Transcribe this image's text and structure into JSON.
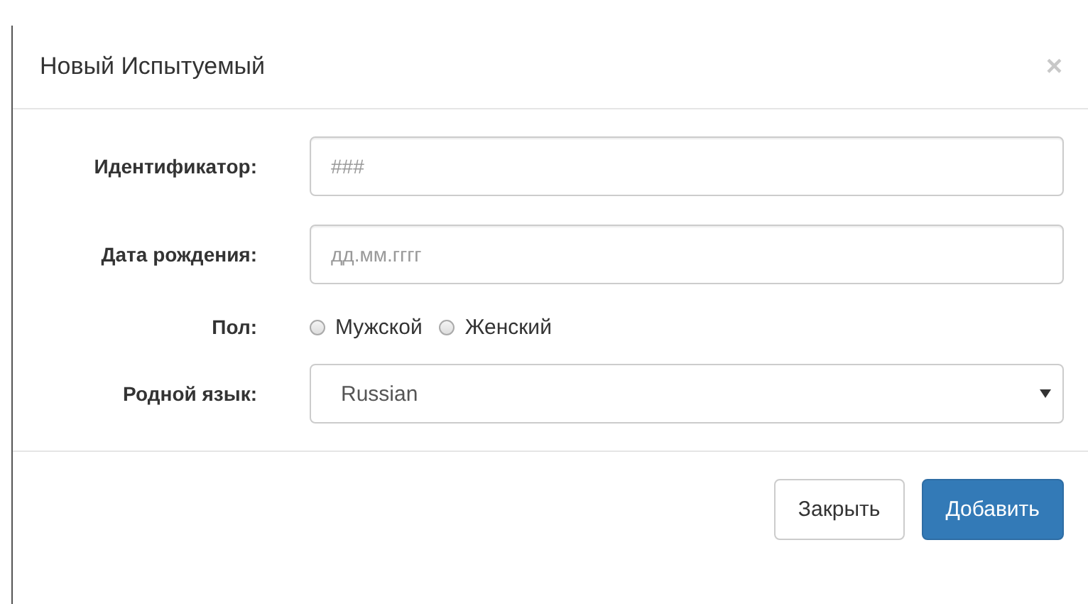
{
  "modal": {
    "title": "Новый Испытуемый",
    "close": "×"
  },
  "fields": [
    {
      "kind": "text",
      "label": "Идентификатор:",
      "placeholder": "###"
    },
    {
      "kind": "text",
      "label": "Дата рождения:",
      "placeholder": "дд.мм.гггг"
    },
    {
      "kind": "radio",
      "label": "Пол:",
      "options": [
        {
          "label": "Мужской",
          "selected": false
        },
        {
          "label": "Женский",
          "selected": false
        }
      ]
    },
    {
      "kind": "select",
      "label": "Родной язык:",
      "value": "Russian"
    }
  ],
  "buttons": [
    {
      "label": "Закрыть",
      "kind": "default"
    },
    {
      "label": "Добавить",
      "kind": "primary"
    }
  ]
}
